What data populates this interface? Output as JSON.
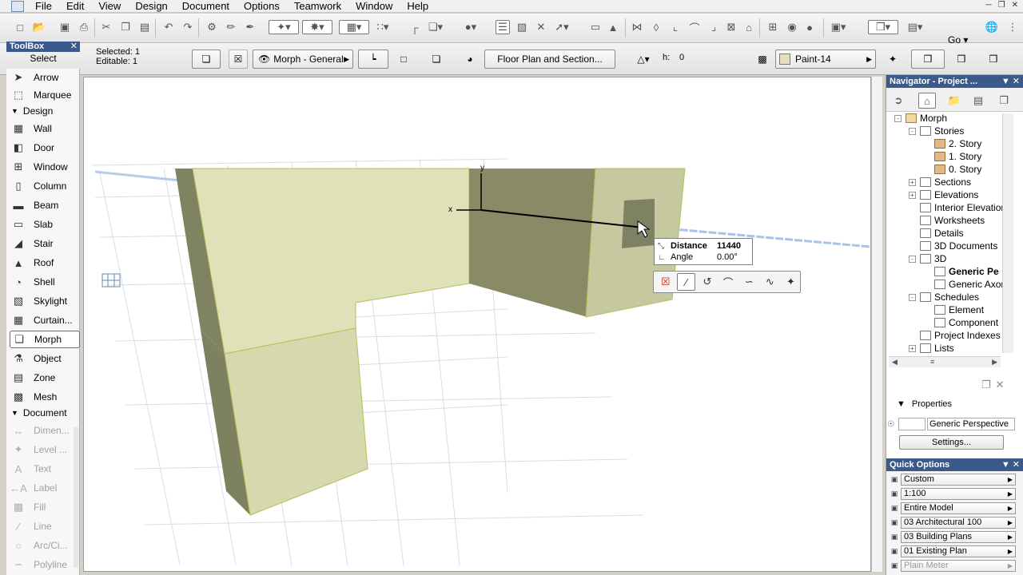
{
  "menu": [
    "File",
    "Edit",
    "View",
    "Design",
    "Document",
    "Options",
    "Teamwork",
    "Window",
    "Help"
  ],
  "window_controls": [
    "minimize-icon",
    "restore-icon",
    "close-icon"
  ],
  "toolbar": {
    "go_label": "Go"
  },
  "info_box": {
    "selected": "Selected: 1",
    "editable": "Editable: 1",
    "favorite": "Morph - General",
    "floor_plan_button": "Floor Plan and Section...",
    "h_label": "h:",
    "h_value": "0",
    "paint": "Paint-14",
    "paint_color": "#e6dfbf"
  },
  "toolbox": {
    "title": "ToolBox",
    "select_header": "Select",
    "select_items": [
      {
        "label": "Arrow",
        "icon": "arrow-cursor-icon"
      },
      {
        "label": "Marquee",
        "icon": "marquee-icon"
      }
    ],
    "design_header": "Design",
    "design_items": [
      {
        "label": "Wall",
        "icon": "wall-icon"
      },
      {
        "label": "Door",
        "icon": "door-icon"
      },
      {
        "label": "Window",
        "icon": "window-icon"
      },
      {
        "label": "Column",
        "icon": "column-icon"
      },
      {
        "label": "Beam",
        "icon": "beam-icon"
      },
      {
        "label": "Slab",
        "icon": "slab-icon"
      },
      {
        "label": "Stair",
        "icon": "stair-icon"
      },
      {
        "label": "Roof",
        "icon": "roof-icon"
      },
      {
        "label": "Shell",
        "icon": "shell-icon"
      },
      {
        "label": "Skylight",
        "icon": "skylight-icon"
      },
      {
        "label": "Curtain...",
        "icon": "curtain-wall-icon"
      },
      {
        "label": "Morph",
        "icon": "morph-icon"
      },
      {
        "label": "Object",
        "icon": "object-icon"
      },
      {
        "label": "Zone",
        "icon": "zone-icon"
      },
      {
        "label": "Mesh",
        "icon": "mesh-icon"
      }
    ],
    "document_header": "Document",
    "document_items": [
      {
        "label": "Dimen...",
        "icon": "dimension-icon"
      },
      {
        "label": "Level ...",
        "icon": "level-dimension-icon"
      },
      {
        "label": "Text",
        "icon": "text-icon"
      },
      {
        "label": "Label",
        "icon": "label-icon"
      },
      {
        "label": "Fill",
        "icon": "fill-icon"
      },
      {
        "label": "Line",
        "icon": "line-icon"
      },
      {
        "label": "Arc/Ci...",
        "icon": "arc-circle-icon"
      },
      {
        "label": "Polyline",
        "icon": "polyline-icon"
      }
    ]
  },
  "viewport": {
    "axis_x": "x",
    "axis_y": "y",
    "tracker": {
      "distance_label": "Distance",
      "distance_value": "11440",
      "angle_label": "Angle",
      "angle_value": "0.00°"
    }
  },
  "navigator": {
    "title": "Navigator - Project ...",
    "tree": [
      {
        "label": "Morph",
        "level": 0,
        "icon": "project-icon",
        "expander": "-"
      },
      {
        "label": "Stories",
        "level": 1,
        "icon": "stories-icon",
        "expander": "-"
      },
      {
        "label": "2. Story",
        "level": 2,
        "icon": "story-icon"
      },
      {
        "label": "1. Story",
        "level": 2,
        "icon": "story-icon"
      },
      {
        "label": "0. Story",
        "level": 2,
        "icon": "story-icon"
      },
      {
        "label": "Sections",
        "level": 1,
        "icon": "sections-icon",
        "expander": "+"
      },
      {
        "label": "Elevations",
        "level": 1,
        "icon": "elevations-icon",
        "expander": "+"
      },
      {
        "label": "Interior Elevation",
        "level": 1,
        "icon": "interior-elevation-icon"
      },
      {
        "label": "Worksheets",
        "level": 1,
        "icon": "worksheets-icon"
      },
      {
        "label": "Details",
        "level": 1,
        "icon": "details-icon"
      },
      {
        "label": "3D Documents",
        "level": 1,
        "icon": "3d-documents-icon"
      },
      {
        "label": "3D",
        "level": 1,
        "icon": "3d-icon",
        "expander": "-"
      },
      {
        "label": "Generic Pe",
        "level": 2,
        "icon": "perspective-icon",
        "selected": true
      },
      {
        "label": "Generic Axon",
        "level": 2,
        "icon": "axonometry-icon"
      },
      {
        "label": "Schedules",
        "level": 1,
        "icon": "schedules-icon",
        "expander": "-"
      },
      {
        "label": "Element",
        "level": 2,
        "icon": "element-schedule-icon"
      },
      {
        "label": "Component",
        "level": 2,
        "icon": "component-schedule-icon"
      },
      {
        "label": "Project Indexes",
        "level": 1,
        "icon": "project-indexes-icon"
      },
      {
        "label": "Lists",
        "level": 1,
        "icon": "lists-icon",
        "expander": "+"
      }
    ],
    "properties_label": "Properties",
    "properties_value": "Generic Perspective",
    "settings_button": "Settings..."
  },
  "quick_options": {
    "title": "Quick Options",
    "rows": [
      {
        "value": "Custom",
        "icon": "layer-combination-icon"
      },
      {
        "value": "1:100",
        "icon": "scale-icon"
      },
      {
        "value": "Entire Model",
        "icon": "structure-display-icon"
      },
      {
        "value": "03 Architectural 100",
        "icon": "pen-set-icon"
      },
      {
        "value": "03 Building Plans",
        "icon": "model-view-icon"
      },
      {
        "value": "01 Existing Plan",
        "icon": "renovation-filter-icon"
      },
      {
        "value": "Plain Meter",
        "icon": "dimension-standard-icon",
        "disabled": true
      }
    ]
  }
}
